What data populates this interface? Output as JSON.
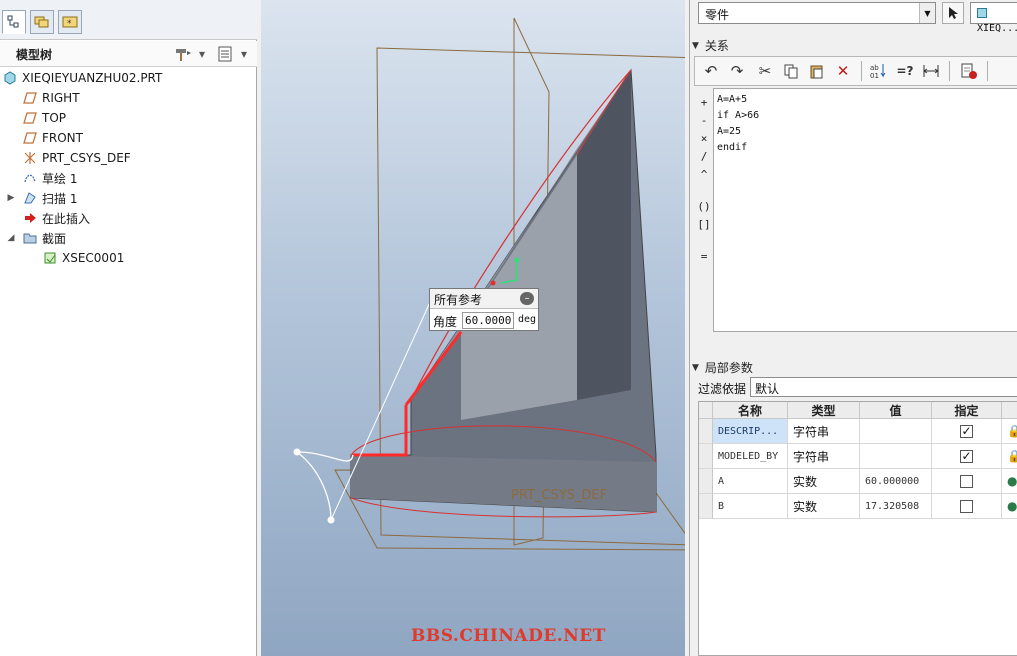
{
  "tree_panel": {
    "title": "模型树",
    "items": [
      {
        "label": "XIEQIEYUANZHU02.PRT",
        "icon": "part-icon"
      },
      {
        "label": "RIGHT",
        "icon": "datum-plane-icon"
      },
      {
        "label": "TOP",
        "icon": "datum-plane-icon"
      },
      {
        "label": "FRONT",
        "icon": "datum-plane-icon"
      },
      {
        "label": "PRT_CSYS_DEF",
        "icon": "coordinate-system-icon"
      },
      {
        "label": "草绘 1",
        "icon": "sketch-icon"
      },
      {
        "label": "扫描 1",
        "icon": "sweep-icon"
      },
      {
        "label": "在此插入",
        "icon": "insert-here-icon"
      },
      {
        "label": "截面",
        "icon": "folder-icon"
      },
      {
        "label": "XSEC0001",
        "icon": "section-icon"
      }
    ]
  },
  "viewport": {
    "dim_box_title": "所有参考",
    "dim_label": "角度",
    "dim_value": "60.0000",
    "dim_unit": "deg",
    "csys_label": "PRT_CSYS_DEF",
    "watermark": "BBS.CHINADE.NET"
  },
  "right_panel": {
    "type_select": "零件",
    "model_select": "XIEQ...",
    "relations_title": "关系",
    "relations_lines": [
      "A=A+5",
      "if A>66",
      "A=25",
      "endif"
    ],
    "operators": [
      "+",
      "-",
      "×",
      "/",
      "^",
      "()",
      "[]",
      "="
    ],
    "local_params_title": "局部参数",
    "filter_label": "过滤依据",
    "filter_value": "默认",
    "columns": [
      "名称",
      "类型",
      "值",
      "指定"
    ],
    "rows": [
      {
        "name": "DESCRIP...",
        "type": "字符串",
        "value": "",
        "designated": true
      },
      {
        "name": "MODELED_BY",
        "type": "字符串",
        "value": "",
        "designated": true
      },
      {
        "name": "A",
        "type": "实数",
        "value": "60.000000",
        "designated": false
      },
      {
        "name": "B",
        "type": "实数",
        "value": "17.320508",
        "designated": false
      }
    ]
  }
}
